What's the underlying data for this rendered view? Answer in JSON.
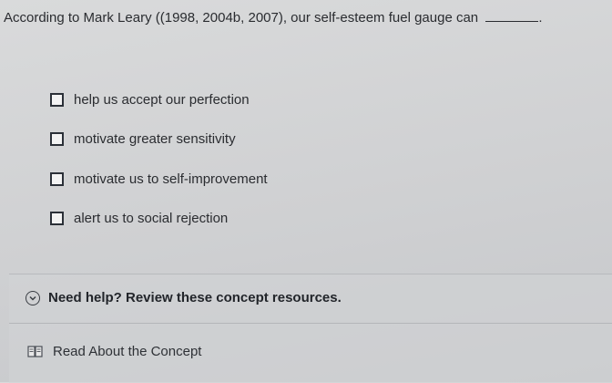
{
  "question": {
    "text": "According to Mark Leary ((1998, 2004b, 2007), our self-esteem fuel gauge can",
    "blank_suffix": "."
  },
  "options": [
    {
      "label": "help us accept our perfection",
      "checked": false
    },
    {
      "label": "motivate greater sensitivity",
      "checked": false
    },
    {
      "label": "motivate us to self-improvement",
      "checked": false
    },
    {
      "label": "alert us to social rejection",
      "checked": false
    }
  ],
  "help": {
    "header": "Need help? Review these concept resources.",
    "header_icon": "chevron-down-circle-icon",
    "resources": [
      {
        "label": "Read About the Concept",
        "icon": "book-icon"
      }
    ]
  }
}
